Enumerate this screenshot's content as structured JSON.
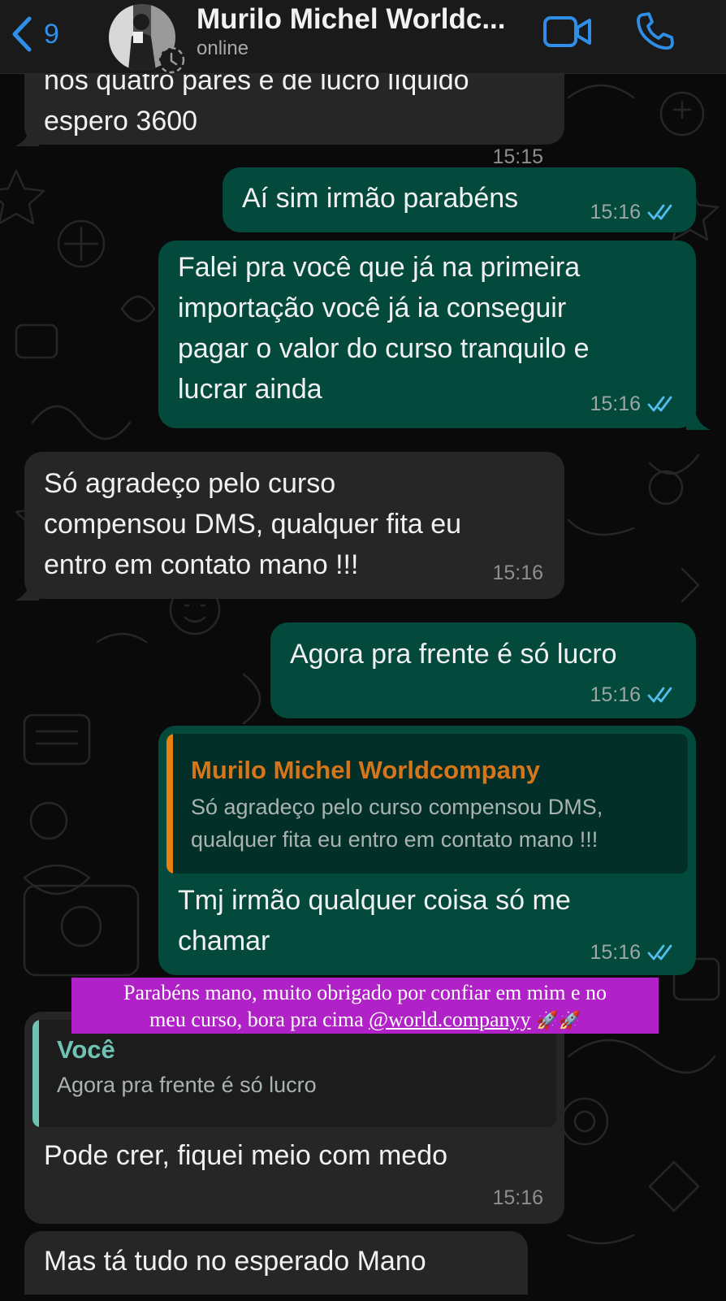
{
  "header": {
    "back_count": "9",
    "contact_name": "Murilo Michel Worldc...",
    "contact_status": "online"
  },
  "messages": [
    {
      "direction": "in",
      "text_top_cut": "nos quatro pares e de lucro líquido",
      "text": "espero 3600",
      "time": "15:15"
    },
    {
      "direction": "out",
      "text": "Aí sim irmão parabéns",
      "time": "15:16",
      "read": true
    },
    {
      "direction": "out",
      "text": "Falei pra você que já na primeira\nimportação você já ia conseguir\npagar o valor do curso tranquilo e\nlucrar ainda",
      "time": "15:16",
      "read": true
    },
    {
      "direction": "in",
      "text": "Só agradeço pelo curso\ncompensou DMS, qualquer fita eu\nentro em contato mano !!!",
      "time": "15:16"
    },
    {
      "direction": "out",
      "text": "Agora pra frente é só lucro",
      "time": "15:16",
      "read": true
    },
    {
      "direction": "out",
      "reply_to": {
        "name": "Murilo Michel Worldcompany",
        "text": "Só agradeço pelo curso compensou DMS,\nqualquer fita eu entro em contato mano !!!"
      },
      "text": "Tmj irmão qualquer coisa só me\nchamar",
      "time": "15:16",
      "read": true
    },
    {
      "direction": "in",
      "reply_to": {
        "name": "Você",
        "text": "Agora pra frente é só lucro"
      },
      "text": "Pode crer, fiquei meio com medo",
      "time": "15:16"
    },
    {
      "direction": "in",
      "text": "Mas tá tudo no esperado Mano"
    }
  ],
  "story_caption": {
    "line1": "Parabéns mano, muito obrigado por confiar em mim e no",
    "line2_prefix": "meu curso, bora pra cima ",
    "mention": "@world.companyy",
    "emoji": "🚀🚀"
  },
  "colors": {
    "incoming_bubble": "#262626",
    "outgoing_bubble": "#034a3d",
    "accent_blue": "#2f8fe8",
    "read_ticks": "#53bdeb",
    "quote_name_orange": "#d6751a",
    "quote_bar_orange": "#e8800f",
    "quote_name_teal": "#6ec3b4",
    "caption_background": "#b022c8"
  },
  "icons": [
    "chevron-left-icon",
    "video-call-icon",
    "phone-icon",
    "double-check-icon",
    "status-ring-icon"
  ]
}
